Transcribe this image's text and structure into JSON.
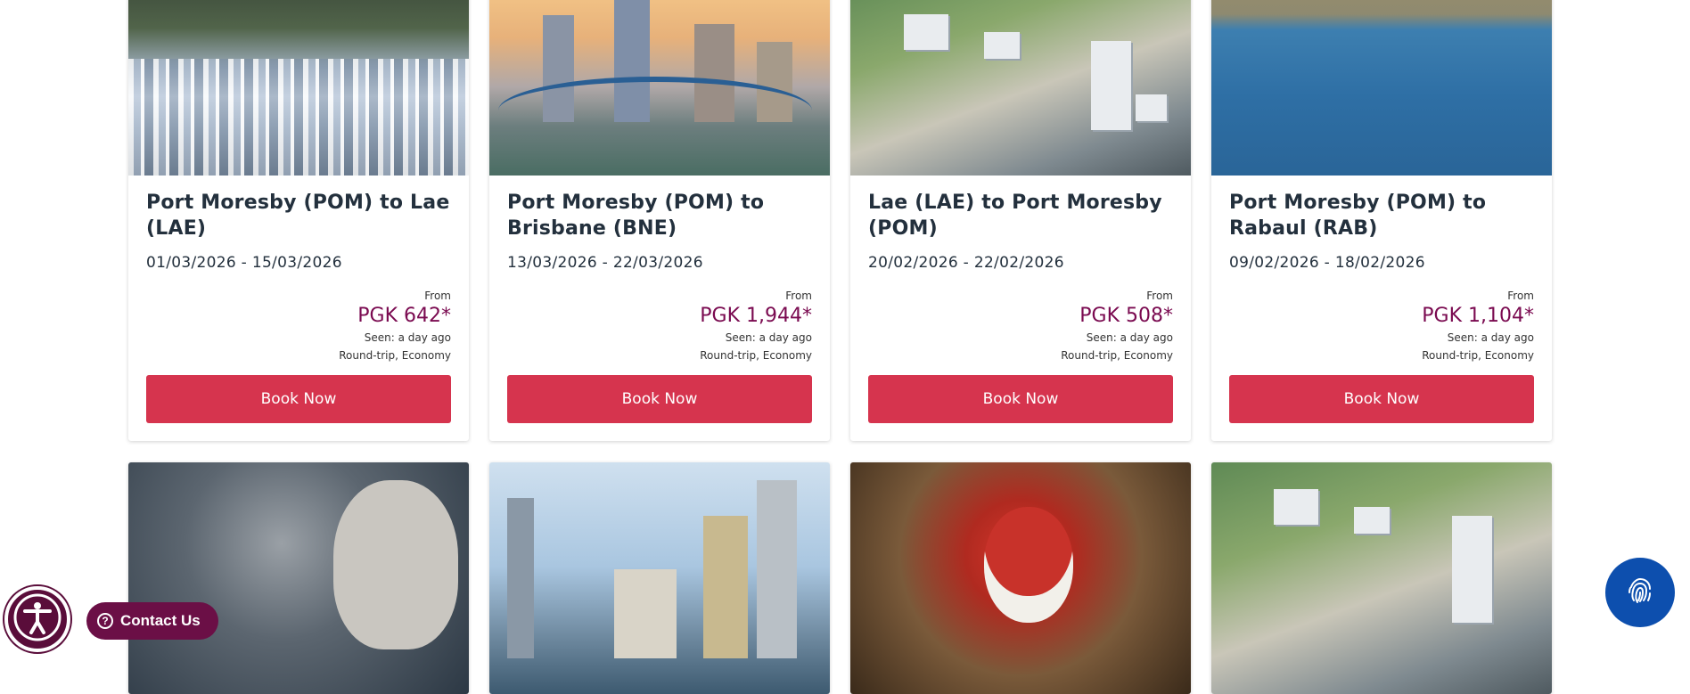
{
  "deals_row1": [
    {
      "route": "Port Moresby (POM) to Lae (LAE)",
      "dates": "01/03/2026 - 15/03/2026",
      "from_label": "From",
      "price": "PGK 642*",
      "seen": "Seen: a day ago",
      "trip": "Round-trip, Economy",
      "button": "Book Now",
      "image": "waterfall"
    },
    {
      "route": "Port Moresby (POM) to Brisbane (BNE)",
      "dates": "13/03/2026 - 22/03/2026",
      "from_label": "From",
      "price": "PGK 1,944*",
      "seen": "Seen: a day ago",
      "trip": "Round-trip, Economy",
      "button": "Book Now",
      "image": "brisbane-skyline"
    },
    {
      "route": "Lae (LAE) to Port Moresby (POM)",
      "dates": "20/02/2026 - 22/02/2026",
      "from_label": "From",
      "price": "PGK 508*",
      "seen": "Seen: a day ago",
      "trip": "Round-trip, Economy",
      "button": "Book Now",
      "image": "port-moresby-aerial"
    },
    {
      "route": "Port Moresby (POM) to Rabaul (RAB)",
      "dates": "09/02/2026 - 18/02/2026",
      "from_label": "From",
      "price": "PGK 1,104*",
      "seen": "Seen: a day ago",
      "trip": "Round-trip, Economy",
      "button": "Book Now",
      "image": "ocean-boat"
    }
  ],
  "deals_row2_images": [
    "carved-mask",
    "harbour-skyline",
    "painted-face",
    "port-moresby-aerial"
  ],
  "widgets": {
    "contact_label": "Contact Us",
    "help_glyph": "?",
    "accessibility_icon": "accessibility-icon",
    "fingerprint_icon": "fingerprint-icon"
  },
  "colors": {
    "price": "#7a0a50",
    "book_button": "#d6344e",
    "contact": "#6b0f46",
    "fingerprint_button": "#0d4fae"
  }
}
